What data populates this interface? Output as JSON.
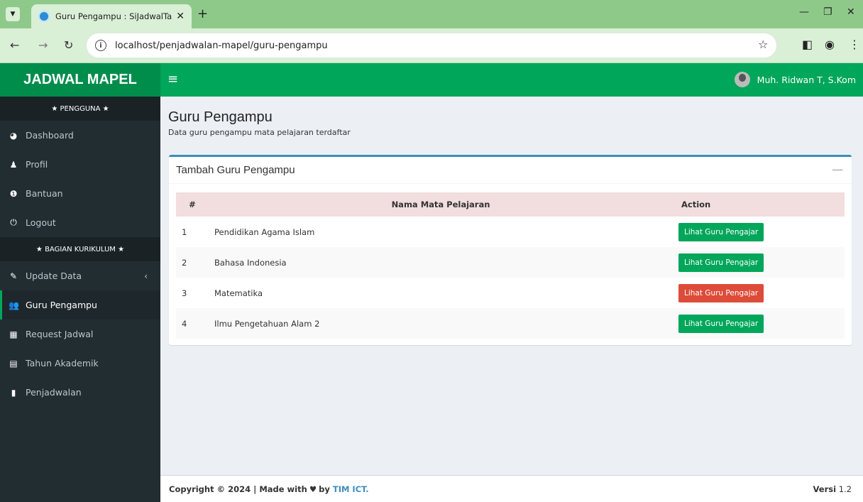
{
  "browser": {
    "tab_title": "Guru Pengampu : SiJadwalTa",
    "url": "localhost/penjadwalan-mapel/guru-pengampu"
  },
  "app": {
    "logo": "JADWAL MAPEL",
    "user_name": "Muh. Ridwan T, S.Kom"
  },
  "sidebar": {
    "section1": "★ PENGGUNA ★",
    "items1": [
      {
        "label": "Dashboard",
        "icon": "dashboard-icon"
      },
      {
        "label": "Profil",
        "icon": "user-icon"
      },
      {
        "label": "Bantuan",
        "icon": "info-icon"
      },
      {
        "label": "Logout",
        "icon": "power-icon"
      }
    ],
    "section2": "★ BAGIAN KURIKULUM ★",
    "items2": [
      {
        "label": "Update Data",
        "icon": "edit-icon"
      },
      {
        "label": "Guru Pengampu",
        "icon": "users-icon"
      },
      {
        "label": "Request Jadwal",
        "icon": "table-icon"
      },
      {
        "label": "Tahun Akademik",
        "icon": "calendar-icon"
      },
      {
        "label": "Penjadwalan",
        "icon": "file-icon"
      }
    ]
  },
  "page": {
    "title": "Guru Pengampu",
    "subtitle": "Data guru pengampu mata pelajaran terdaftar"
  },
  "box": {
    "title": "Tambah Guru Pengampu"
  },
  "table": {
    "headers": [
      "#",
      "Nama Mata Pelajaran",
      "Action"
    ],
    "rows": [
      {
        "no": "1",
        "name": "Pendidikan Agama Islam",
        "action": "Lihat Guru Pengajar",
        "color": "#00a65a"
      },
      {
        "no": "2",
        "name": "Bahasa Indonesia",
        "action": "Lihat Guru Pengajar",
        "color": "#00a65a"
      },
      {
        "no": "3",
        "name": "Matematika",
        "action": "Lihat Guru Pengajar",
        "color": "#dd4b39"
      },
      {
        "no": "4",
        "name": "Ilmu Pengetahuan Alam 2",
        "action": "Lihat Guru Pengajar",
        "color": "#00a65a"
      }
    ]
  },
  "footer": {
    "copyright": "Copyright © 2024 | Made with",
    "by": "by",
    "link": "TIM ICT.",
    "version_label": "Versi",
    "version_value": "1.2"
  },
  "colors": {
    "primary": "#00a65a",
    "primary_dark": "#008d4c",
    "sidebar": "#222d32",
    "danger": "#dd4b39"
  }
}
